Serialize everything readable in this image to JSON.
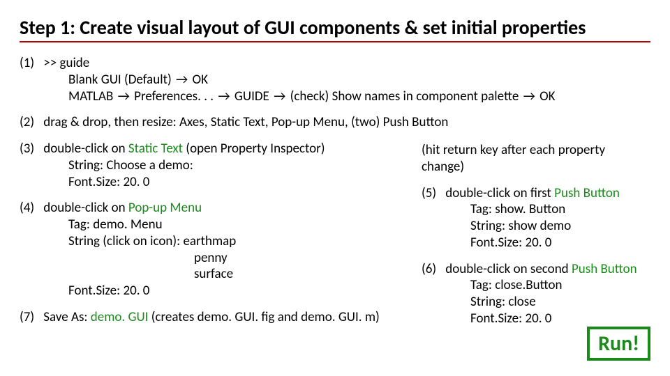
{
  "title": "Step 1:  Create visual layout of GUI components & set initial properties",
  "arrow": "→",
  "s1": {
    "num": "(1)",
    "l1": ">> guide",
    "l2a": "Blank GUI (Default) ",
    "l2b": " OK",
    "l3a": "MATLAB ",
    "l3b": " Preferences. . . ",
    "l3c": " GUIDE ",
    "l3d": " (check) Show names in component palette ",
    "l3e": " OK"
  },
  "s2": {
    "num": "(2)",
    "text": "drag & drop, then resize:   Axes,   Static Text,   Pop-up Menu,   (two) Push Button"
  },
  "s3": {
    "num": "(3)",
    "l1a": "double-click on ",
    "l1b": "Static Text",
    "l1c": " (open Property Inspector)",
    "l2": "String:      Choose a demo:",
    "l3": "Font.Size:     20. 0"
  },
  "s4": {
    "num": "(4)",
    "l1a": "double-click on ",
    "l1b": "Pop-up Menu",
    "l2": "Tag:       demo. Menu",
    "l3": "String (click on icon):     earthmap",
    "l4": "penny",
    "l5": "surface",
    "l6": "Font.Size:    20. 0"
  },
  "right": {
    "note": "(hit return key after each property change)",
    "s5": {
      "num": "(5)",
      "l1a": "double-click on first ",
      "l1b": "Push Button",
      "l2": "Tag:          show. Button",
      "l3": "String:      show demo",
      "l4": "Font.Size:     20. 0"
    },
    "s6": {
      "num": "(6)",
      "l1a": "double-click on second ",
      "l1b": "Push Button",
      "l2": "Tag:           close.Button",
      "l3": "String:       close",
      "l4": "Font.Size:     20. 0"
    }
  },
  "s7": {
    "num": "(7)",
    "l1a": "Save As:        ",
    "l1b": "demo. GUI",
    "l1c": "        (creates demo. GUI. fig and demo. GUI. m)"
  },
  "run": "Run!"
}
